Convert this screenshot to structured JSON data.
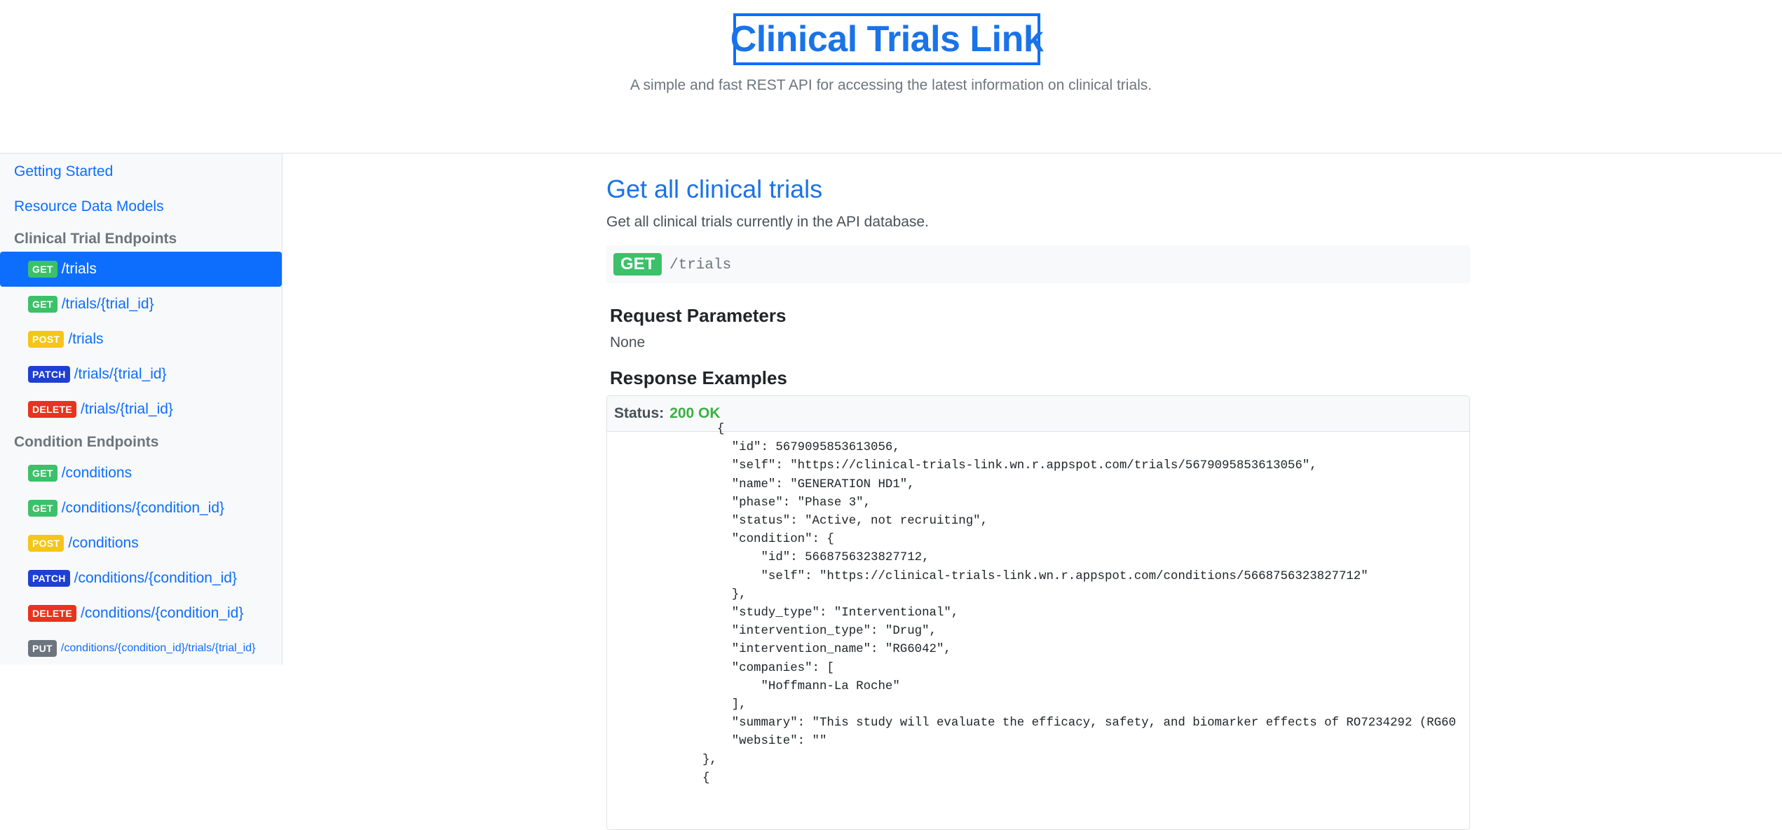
{
  "header": {
    "title": "Clinical Trials Link",
    "subtitle": "A simple and fast REST API for accessing the latest information on clinical trials."
  },
  "sidebar": {
    "links": [
      "Getting Started",
      "Resource Data Models"
    ],
    "sections": [
      {
        "heading": "Clinical Trial Endpoints",
        "items": [
          {
            "method": "GET",
            "path": "/trials",
            "active": true
          },
          {
            "method": "GET",
            "path": "/trials/{trial_id}"
          },
          {
            "method": "POST",
            "path": "/trials"
          },
          {
            "method": "PATCH",
            "path": "/trials/{trial_id}"
          },
          {
            "method": "DELETE",
            "path": "/trials/{trial_id}"
          }
        ]
      },
      {
        "heading": "Condition Endpoints",
        "items": [
          {
            "method": "GET",
            "path": "/conditions"
          },
          {
            "method": "GET",
            "path": "/conditions/{condition_id}"
          },
          {
            "method": "POST",
            "path": "/conditions"
          },
          {
            "method": "PATCH",
            "path": "/conditions/{condition_id}"
          },
          {
            "method": "DELETE",
            "path": "/conditions/{condition_id}"
          },
          {
            "method": "PUT",
            "path": "/conditions/{condition_id}/trials/{trial_id}"
          }
        ]
      }
    ]
  },
  "main": {
    "title": "Get all clinical trials",
    "description": "Get all clinical trials currently in the API database.",
    "method": "GET",
    "path": "/trials",
    "request_params_heading": "Request Parameters",
    "request_params_value": "None",
    "response_heading": "Response Examples",
    "status_label": "Status:",
    "status_value": "200 OK",
    "response_body": "  {\n    \"id\": 5679095853613056,\n    \"self\": \"https://clinical-trials-link.wn.r.appspot.com/trials/5679095853613056\",\n    \"name\": \"GENERATION HD1\",\n    \"phase\": \"Phase 3\",\n    \"status\": \"Active, not recruiting\",\n    \"condition\": {\n        \"id\": 5668756323827712,\n        \"self\": \"https://clinical-trials-link.wn.r.appspot.com/conditions/5668756323827712\"\n    },\n    \"study_type\": \"Interventional\",\n    \"intervention_type\": \"Drug\",\n    \"intervention_name\": \"RG6042\",\n    \"companies\": [\n        \"Hoffmann-La Roche\"\n    ],\n    \"summary\": \"This study will evaluate the efficacy, safety, and biomarker effects of RO7234292 (RG60\n    \"website\": \"\"\n},\n{"
  },
  "colors": {
    "accent": "#0d6efd",
    "get": "#3cc16a",
    "post": "#f5c518",
    "patch": "#1d3fd4",
    "delete": "#e8331e",
    "put": "#6c757d",
    "status_ok": "#3cb043"
  }
}
